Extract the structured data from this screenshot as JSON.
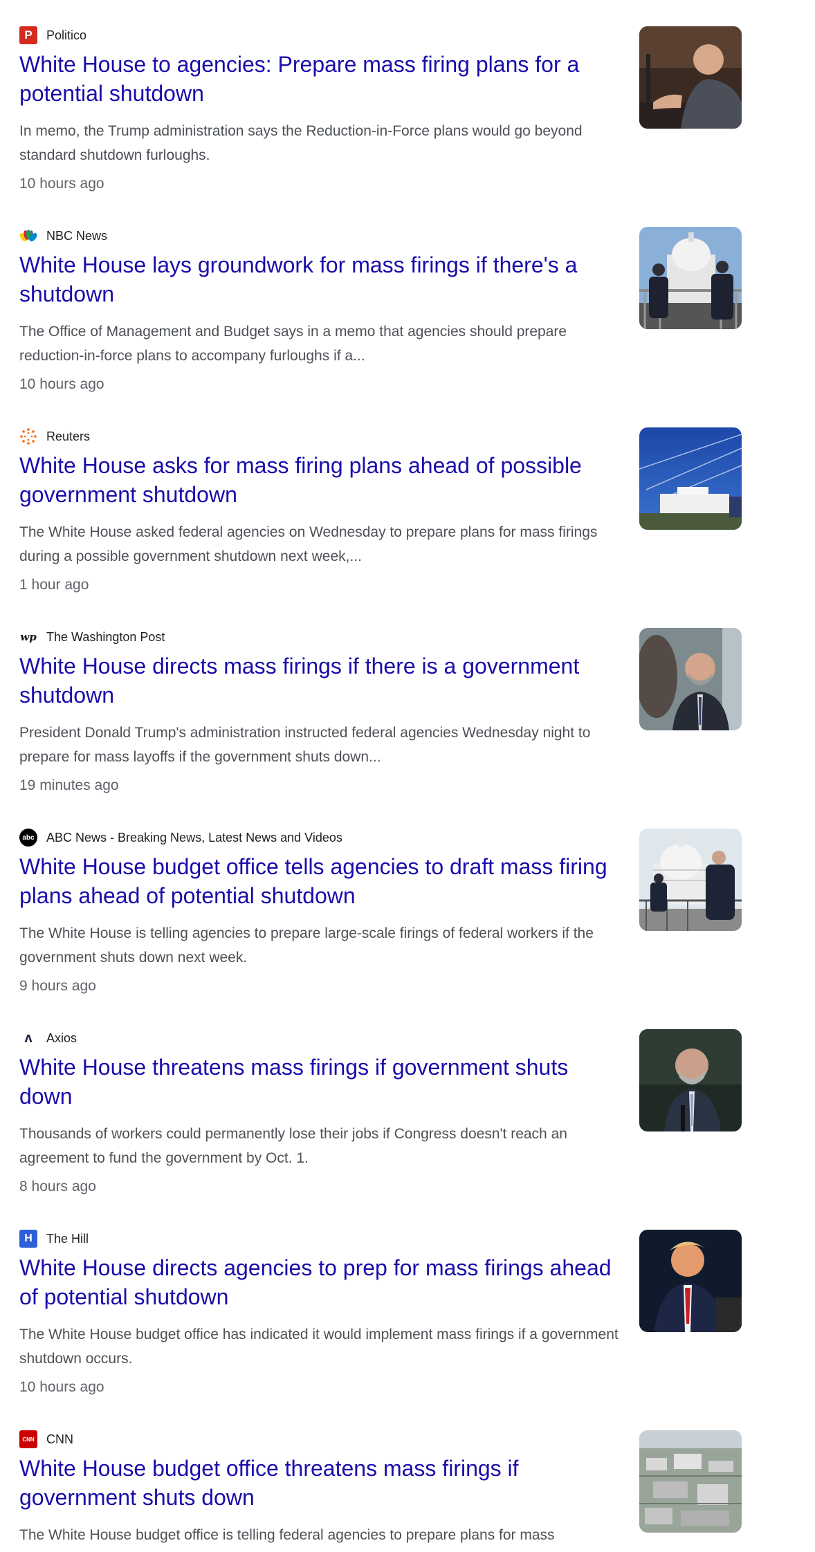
{
  "articles": [
    {
      "source": "Politico",
      "favicon": "politico-p-icon",
      "favicon_color": "#d52b1e",
      "title": "White House to agencies: Prepare mass firing plans for a potential shutdown",
      "snippet": "In memo, the Trump administration says the Reduction-in-Force plans would go beyond standard shutdown furloughs.",
      "time": "10 hours ago",
      "thumbnail": "man-speaking-at-hearing-image"
    },
    {
      "source": "NBC News",
      "favicon": "nbc-peacock-icon",
      "title": "White House lays groundwork for mass firings if there's a shutdown",
      "snippet": "The Office of Management and Budget says in a memo that agencies should prepare reduction-in-force plans to accompany furloughs if a...",
      "time": "10 hours ago",
      "thumbnail": "capitol-police-image"
    },
    {
      "source": "Reuters",
      "favicon": "reuters-dots-icon",
      "favicon_color": "#fa6400",
      "title": "White House asks for mass firing plans ahead of possible government shutdown",
      "snippet": "The White House asked federal agencies on Wednesday to prepare plans for mass firings during a possible government shutdown next week,...",
      "time": "1 hour ago",
      "thumbnail": "white-house-sky-image"
    },
    {
      "source": "The Washington Post",
      "favicon": "wp-logo-icon",
      "title": "White House directs mass firings if there is a government shutdown",
      "snippet": "President Donald Trump's administration instructed federal agencies Wednesday night to prepare for mass layoffs if the government shuts down...",
      "time": "19 minutes ago",
      "thumbnail": "man-in-suit-image"
    },
    {
      "source": "ABC News - Breaking News, Latest News and Videos",
      "favicon": "abc-logo-icon",
      "title": "White House budget office tells agencies to draft mass firing plans ahead of potential shutdown",
      "snippet": "The White House is telling agencies to prepare large-scale firings of federal workers if the government shuts down next week.",
      "time": "9 hours ago",
      "thumbnail": "capitol-officers-image"
    },
    {
      "source": "Axios",
      "favicon": "axios-logo-icon",
      "title": "White House threatens mass firings if government shuts down",
      "snippet": "Thousands of workers could permanently lose their jobs if Congress doesn't reach an agreement to fund the government by Oct. 1.",
      "time": "8 hours ago",
      "thumbnail": "man-at-podium-image"
    },
    {
      "source": "The Hill",
      "favicon": "the-hill-logo-icon",
      "favicon_color": "#2c5fd8",
      "title": "White House directs agencies to prep for mass firings ahead of potential shutdown",
      "snippet": "The White House budget office has indicated it would implement mass firings if a government shutdown occurs.",
      "time": "10 hours ago",
      "thumbnail": "trump-speaking-image"
    },
    {
      "source": "CNN",
      "favicon": "cnn-logo-icon",
      "favicon_color": "#cc0000",
      "title": "White House budget office threatens mass firings if government shuts down",
      "snippet": "The White House budget office is telling federal agencies to prepare plans for mass",
      "time": "",
      "thumbnail": "aerial-washington-image"
    }
  ],
  "icon_glyphs": {
    "politico": "P",
    "the_hill": "H",
    "cnn": "CNN",
    "abc": "abc",
    "axios": "ʌ",
    "wp": "wp"
  }
}
